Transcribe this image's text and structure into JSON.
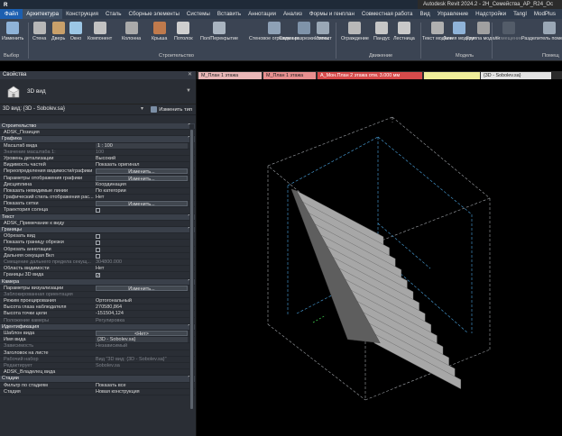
{
  "app": {
    "title": "Autodesk Revit 2024.2 - 2Н_Семейства_АР_R24_Ос"
  },
  "menu": [
    {
      "label": "Файл",
      "kind": "file"
    },
    {
      "label": "Архитектура",
      "kind": "active"
    },
    {
      "label": "Конструкция",
      "kind": ""
    },
    {
      "label": "Сталь",
      "kind": ""
    },
    {
      "label": "Сборные элементы",
      "kind": ""
    },
    {
      "label": "Системы",
      "kind": ""
    },
    {
      "label": "Вставить",
      "kind": ""
    },
    {
      "label": "Аннотации",
      "kind": ""
    },
    {
      "label": "Анализ",
      "kind": ""
    },
    {
      "label": "Формы и генплан",
      "kind": ""
    },
    {
      "label": "Совместная работа",
      "kind": ""
    },
    {
      "label": "Вид",
      "kind": ""
    },
    {
      "label": "Управление",
      "kind": ""
    },
    {
      "label": "Надстройки",
      "kind": ""
    },
    {
      "label": "Tangl",
      "kind": ""
    },
    {
      "label": "ModPlus",
      "kind": ""
    },
    {
      "label": "Изменить",
      "kind": ""
    }
  ],
  "ribbon": {
    "buttons": [
      {
        "label": "Изменить",
        "color": "#8fb3d8"
      },
      {
        "label": "Стена",
        "color": "#b7b7b7"
      },
      {
        "label": "Дверь",
        "color": "#c9a06a"
      },
      {
        "label": "Окно",
        "color": "#9cc7e6"
      },
      {
        "label": "Компонент",
        "color": "#c2c2c2"
      },
      {
        "label": "Колонна",
        "color": "#aaaaaa"
      },
      {
        "label": "Крыша",
        "color": "#c07a4c"
      },
      {
        "label": "Потолок",
        "color": "#cfcfcf"
      },
      {
        "label": "Пол/Перекрытие",
        "color": "#a9b4c0"
      },
      {
        "label": "Стеновое ограждение",
        "color": "#8ea1b6"
      },
      {
        "label": "Схема разрезки стены",
        "color": "#7f93a9"
      },
      {
        "label": "Импост",
        "color": "#9aa7b5"
      },
      {
        "label": "Ограждение",
        "color": "#b8b8b8"
      },
      {
        "label": "Пандус",
        "color": "#c6c6c6"
      },
      {
        "label": "Лестница",
        "color": "#c9c9c9"
      },
      {
        "label": "Текст модели",
        "color": "#b0b0b0"
      },
      {
        "label": "Линия модели",
        "color": "#8fb3d8"
      },
      {
        "label": "Группа модели",
        "color": "#a0a0a0"
      },
      {
        "label": "Помещение",
        "color": "#6b7480"
      },
      {
        "label": "Разделитель помещений",
        "color": "#9aa7b5"
      }
    ],
    "groups": [
      {
        "label": "Выбор"
      },
      {
        "label": "Строительство"
      },
      {
        "label": "Движение"
      },
      {
        "label": "Модель"
      },
      {
        "label": "Помещ"
      }
    ]
  },
  "project_tabs": [
    {
      "label": "М_План 1 этажа",
      "color": "#e9b7b7"
    },
    {
      "label": "М_План 1 этажа",
      "color": "#e88f8f"
    },
    {
      "label": "А_Мон.План 2 этажа отм. 3.000 мм",
      "color": "#d64b4b"
    },
    {
      "label": "",
      "color": "#f0ee9a"
    },
    {
      "label": "{3D - Sobolev.sa}",
      "color": "#e4e4e4"
    }
  ],
  "properties": {
    "header": "Свойства",
    "close": "✕",
    "type_name": "3D вид",
    "view_selector": "3D вид: {3D - Sobolev.sa}",
    "edit_type": "Изменить тип",
    "rows": [
      {
        "kind": "section",
        "name": "Строительство"
      },
      {
        "kind": "prop",
        "name": "ADSK_Позиция",
        "value": ""
      },
      {
        "kind": "section",
        "name": "Графика"
      },
      {
        "kind": "prop",
        "name": "Масштаб вида",
        "value": "1 : 100",
        "field": true
      },
      {
        "kind": "prop",
        "name": "Значение масштаба    1:",
        "value": "100",
        "dim": true
      },
      {
        "kind": "prop",
        "name": "Уровень детализации",
        "value": "Высокий"
      },
      {
        "kind": "prop",
        "name": "Видимость частей",
        "value": "Показать оригинал"
      },
      {
        "kind": "prop",
        "name": "Переопределения видимости/графики",
        "button": "Изменить..."
      },
      {
        "kind": "prop",
        "name": "Параметры отображения графики",
        "button": "Изменить..."
      },
      {
        "kind": "prop",
        "name": "Дисциплина",
        "value": "Координация"
      },
      {
        "kind": "prop",
        "name": "Показать невидимые линии",
        "value": "По категории"
      },
      {
        "kind": "prop",
        "name": "Графический стиль отображения рас...",
        "value": "Нет"
      },
      {
        "kind": "prop",
        "name": "Показать сетки",
        "button": "Изменить..."
      },
      {
        "kind": "prop",
        "name": "Траектория солнца",
        "check": false
      },
      {
        "kind": "section",
        "name": "Текст"
      },
      {
        "kind": "prop",
        "name": "ADSK_Примечание к виду",
        "value": ""
      },
      {
        "kind": "section",
        "name": "Границы"
      },
      {
        "kind": "prop",
        "name": "Обрезать вид",
        "check": false
      },
      {
        "kind": "prop",
        "name": "Показать границу обрезки",
        "check": false
      },
      {
        "kind": "prop",
        "name": "Обрезать аннотации",
        "check": false
      },
      {
        "kind": "prop",
        "name": "Дальняя секущая Вкл",
        "check": false
      },
      {
        "kind": "prop",
        "name": "Смещение дальнего предела секущ...",
        "value": "304800.000",
        "dim": true
      },
      {
        "kind": "prop",
        "name": "Область видимости",
        "value": "Нет"
      },
      {
        "kind": "prop",
        "name": "Границы 3D вида",
        "check": true
      },
      {
        "kind": "section",
        "name": "Камера"
      },
      {
        "kind": "prop",
        "name": "Параметры визуализации",
        "button": "Изменить..."
      },
      {
        "kind": "prop",
        "name": "Заблокированная ориентация",
        "value": "",
        "dim": true
      },
      {
        "kind": "prop",
        "name": "Режим проецирования",
        "value": "Ортогональный"
      },
      {
        "kind": "prop",
        "name": "Высота глаза наблюдателя",
        "value": "270580,864"
      },
      {
        "kind": "prop",
        "name": "Высота точки цели",
        "value": "-151504,124"
      },
      {
        "kind": "prop",
        "name": "Положение камеры",
        "value": "Регулировка",
        "dim": true
      },
      {
        "kind": "section",
        "name": "Идентификация"
      },
      {
        "kind": "prop",
        "name": "Шаблон вида",
        "button": "<Нет>"
      },
      {
        "kind": "prop",
        "name": "Имя вида",
        "value": "{3D - Sobolev.sa}",
        "field": true
      },
      {
        "kind": "prop",
        "name": "Зависимость",
        "value": "Независимый",
        "dim": true
      },
      {
        "kind": "prop",
        "name": "Заголовок на листе",
        "value": ""
      },
      {
        "kind": "prop",
        "name": "Рабочий набор",
        "value": "Вид \"3D вид: {3D - Sobolev.sa}\"",
        "dim": true
      },
      {
        "kind": "prop",
        "name": "Редактирует",
        "value": "Sobolev.sa",
        "dim": true
      },
      {
        "kind": "prop",
        "name": "ADSK_Владелец вида",
        "value": ""
      },
      {
        "kind": "section",
        "name": "Стадии"
      },
      {
        "kind": "prop",
        "name": "Фильтр по стадиям",
        "value": "Показать все"
      },
      {
        "kind": "prop",
        "name": "Стадия",
        "value": "Новая конструкция"
      }
    ]
  },
  "colors": {
    "accent": "#1c5fb0",
    "viewport_bg": "#000000",
    "stair_light": "#d9d9d9",
    "stair_mid": "#a7a7a7",
    "stair_dark": "#5e5e5e",
    "section_box": "#9fa3a8",
    "dash_blue": "#4aa3df"
  }
}
